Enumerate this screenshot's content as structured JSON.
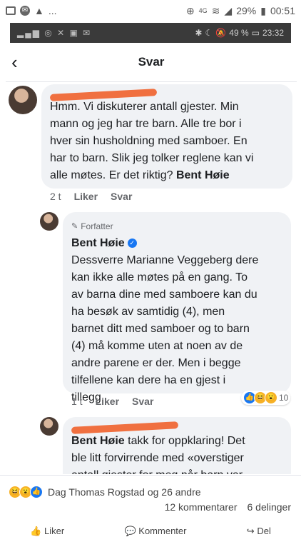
{
  "outer_status": {
    "battery": "29%",
    "time": "00:51",
    "network": "4G"
  },
  "inner_status": {
    "battery": "49 %",
    "time": "23:32"
  },
  "header": {
    "title": "Svar"
  },
  "comments": [
    {
      "text_lines": [
        "Hmm. Vi diskuterer antall gjester. Min",
        "mann og jeg har tre barn. Alle tre bor i",
        "hver sin husholdning med samboer. En",
        "har to barn. Slik jeg tolker reglene kan vi",
        "alle møtes. Er det riktig?"
      ],
      "mention": "Bent Høie",
      "time": "2 t",
      "like": "Liker",
      "reply": "Svar"
    },
    {
      "author_badge": "Forfatter",
      "author_name": "Bent Høie",
      "text_lines": [
        "Dessverre Marianne Veggeberg dere",
        "kan ikke alle møtes på en gang. To",
        "av barna dine med samboere kan du",
        "ha besøk av samtidig (4), men",
        "barnet ditt med samboer og to barn",
        "(4) må komme uten at noen av de",
        "andre parene er der. Men i begge",
        "tilfellene kan dere ha en gjest i",
        "tillegg."
      ],
      "time": "1 t",
      "like": "Liker",
      "reply": "Svar",
      "reaction_count": "10"
    },
    {
      "mention": "Bent Høie",
      "text_lines": [
        " takk for oppklaring! Det",
        "ble litt forvirrende med «overstiger",
        "antall gjester for meg når barn var"
      ]
    }
  ],
  "footer": {
    "reactors": "Dag Thomas Rogstad og 26 andre",
    "comments": "12 kommentarer",
    "shares": "6 delinger",
    "actions": [
      "Liker",
      "Kommenter",
      "Del"
    ]
  },
  "colors": {
    "accent": "#1877f2",
    "redact": "#f07040"
  }
}
